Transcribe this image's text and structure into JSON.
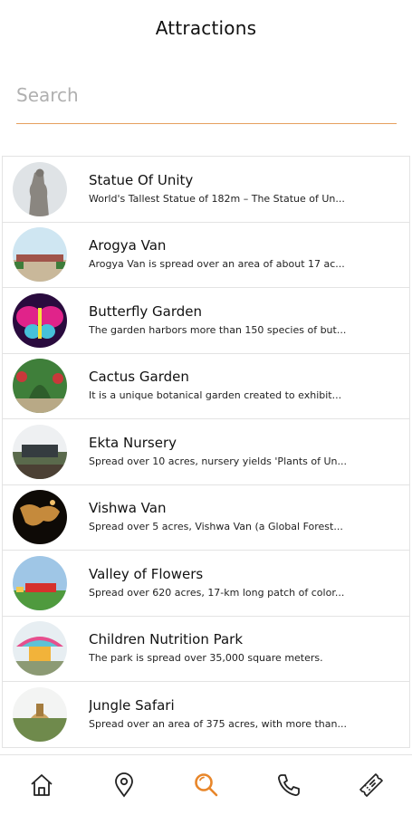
{
  "header": {
    "title": "Attractions"
  },
  "search": {
    "placeholder": "Search",
    "value": ""
  },
  "attractions": [
    {
      "title": "Statue Of Unity",
      "description": "World's Tallest Statue of 182m – The Statue of Un..."
    },
    {
      "title": "Arogya Van",
      "description": "Arogya Van is spread over an area of about 17 ac..."
    },
    {
      "title": "Butterfly Garden",
      "description": "The garden harbors more than 150 species of but..."
    },
    {
      "title": "Cactus Garden",
      "description": "It is a unique botanical garden created to exhibit..."
    },
    {
      "title": "Ekta Nursery",
      "description": "Spread over 10 acres, nursery yields 'Plants of Un..."
    },
    {
      "title": "Vishwa Van",
      "description": "Spread over 5 acres, Vishwa Van (a Global Forest..."
    },
    {
      "title": "Valley of Flowers",
      "description": "Spread over 620 acres, 17-km long patch of color..."
    },
    {
      "title": "Children Nutrition Park",
      "description": "The park is spread over 35,000 square meters."
    },
    {
      "title": "Jungle Safari",
      "description": "Spread over an area of 375 acres, with more than..."
    }
  ],
  "tabbar": {
    "items": [
      {
        "icon": "home-icon",
        "active": false
      },
      {
        "icon": "location-pin-icon",
        "active": false
      },
      {
        "icon": "search-icon",
        "active": true
      },
      {
        "icon": "phone-icon",
        "active": false
      },
      {
        "icon": "ticket-icon",
        "active": false
      }
    ],
    "active_color": "#e8862a",
    "inactive_color": "#222222"
  },
  "colors": {
    "accent": "#e6a05e",
    "divider": "#e3e3e3"
  }
}
